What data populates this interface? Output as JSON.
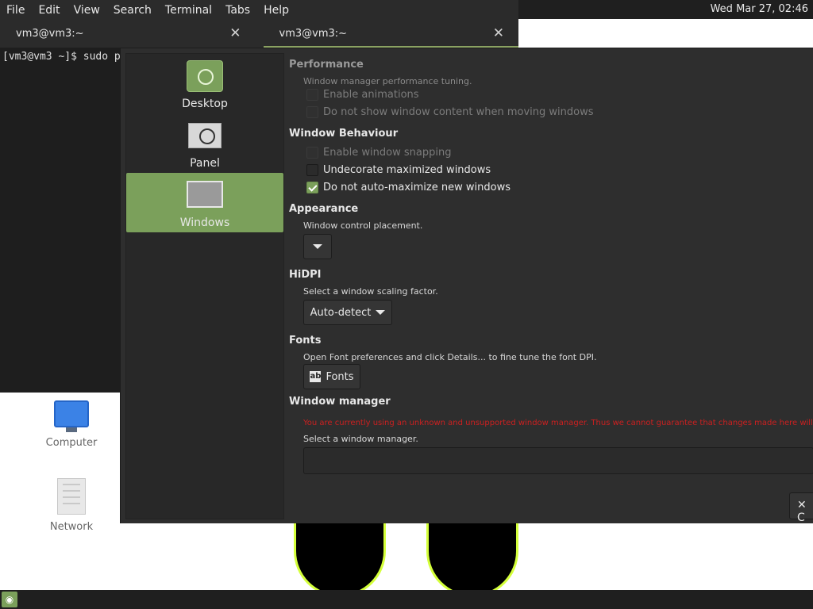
{
  "topbar": {
    "clock": "Wed Mar 27, 02:46"
  },
  "terminal": {
    "menu": [
      "File",
      "Edit",
      "View",
      "Search",
      "Terminal",
      "Tabs",
      "Help"
    ],
    "tabs": [
      {
        "title": "vm3@vm3:~"
      },
      {
        "title": "vm3@vm3:~"
      }
    ],
    "prompt_line": "[vm3@vm3 ~]$ sudo p"
  },
  "desktop": {
    "icons": [
      {
        "label": "Computer",
        "icon": "computer-icon"
      },
      {
        "label": "Network",
        "icon": "network-icon"
      }
    ]
  },
  "dialog": {
    "sidebar": [
      {
        "label": "Desktop",
        "icon": "desktop-settings-icon",
        "active": false
      },
      {
        "label": "Panel",
        "icon": "panel-settings-icon",
        "active": false
      },
      {
        "label": "Windows",
        "icon": "windows-settings-icon",
        "active": true
      }
    ],
    "performance": {
      "title": "Performance",
      "desc": "Window manager performance tuning.",
      "options": [
        {
          "label": "Enable animations",
          "checked": false
        },
        {
          "label": "Do not show window content when moving windows",
          "checked": false
        }
      ]
    },
    "window_behaviour": {
      "title": "Window Behaviour",
      "options": [
        {
          "label": "Enable window snapping",
          "checked": false
        },
        {
          "label": "Undecorate maximized windows",
          "checked": false
        },
        {
          "label": "Do not auto-maximize new windows",
          "checked": true
        }
      ]
    },
    "appearance": {
      "title": "Appearance",
      "desc": "Window control placement."
    },
    "hidpi": {
      "title": "HiDPI",
      "desc": "Select a window scaling factor.",
      "value": "Auto-detect"
    },
    "fonts": {
      "title": "Fonts",
      "desc": "Open Font preferences and click Details... to fine tune the font DPI.",
      "button": "Fonts",
      "icon_glyph": "ab"
    },
    "window_manager": {
      "title": "Window manager",
      "warning": "You are currently using an unknown and unsupported window manager. Thus we cannot guarantee that changes made here will be effective.",
      "desc": "Select a window manager."
    },
    "close_glyph": "✕ C"
  },
  "colors": {
    "accent": "#7ba05b",
    "warning": "#cc2020"
  }
}
